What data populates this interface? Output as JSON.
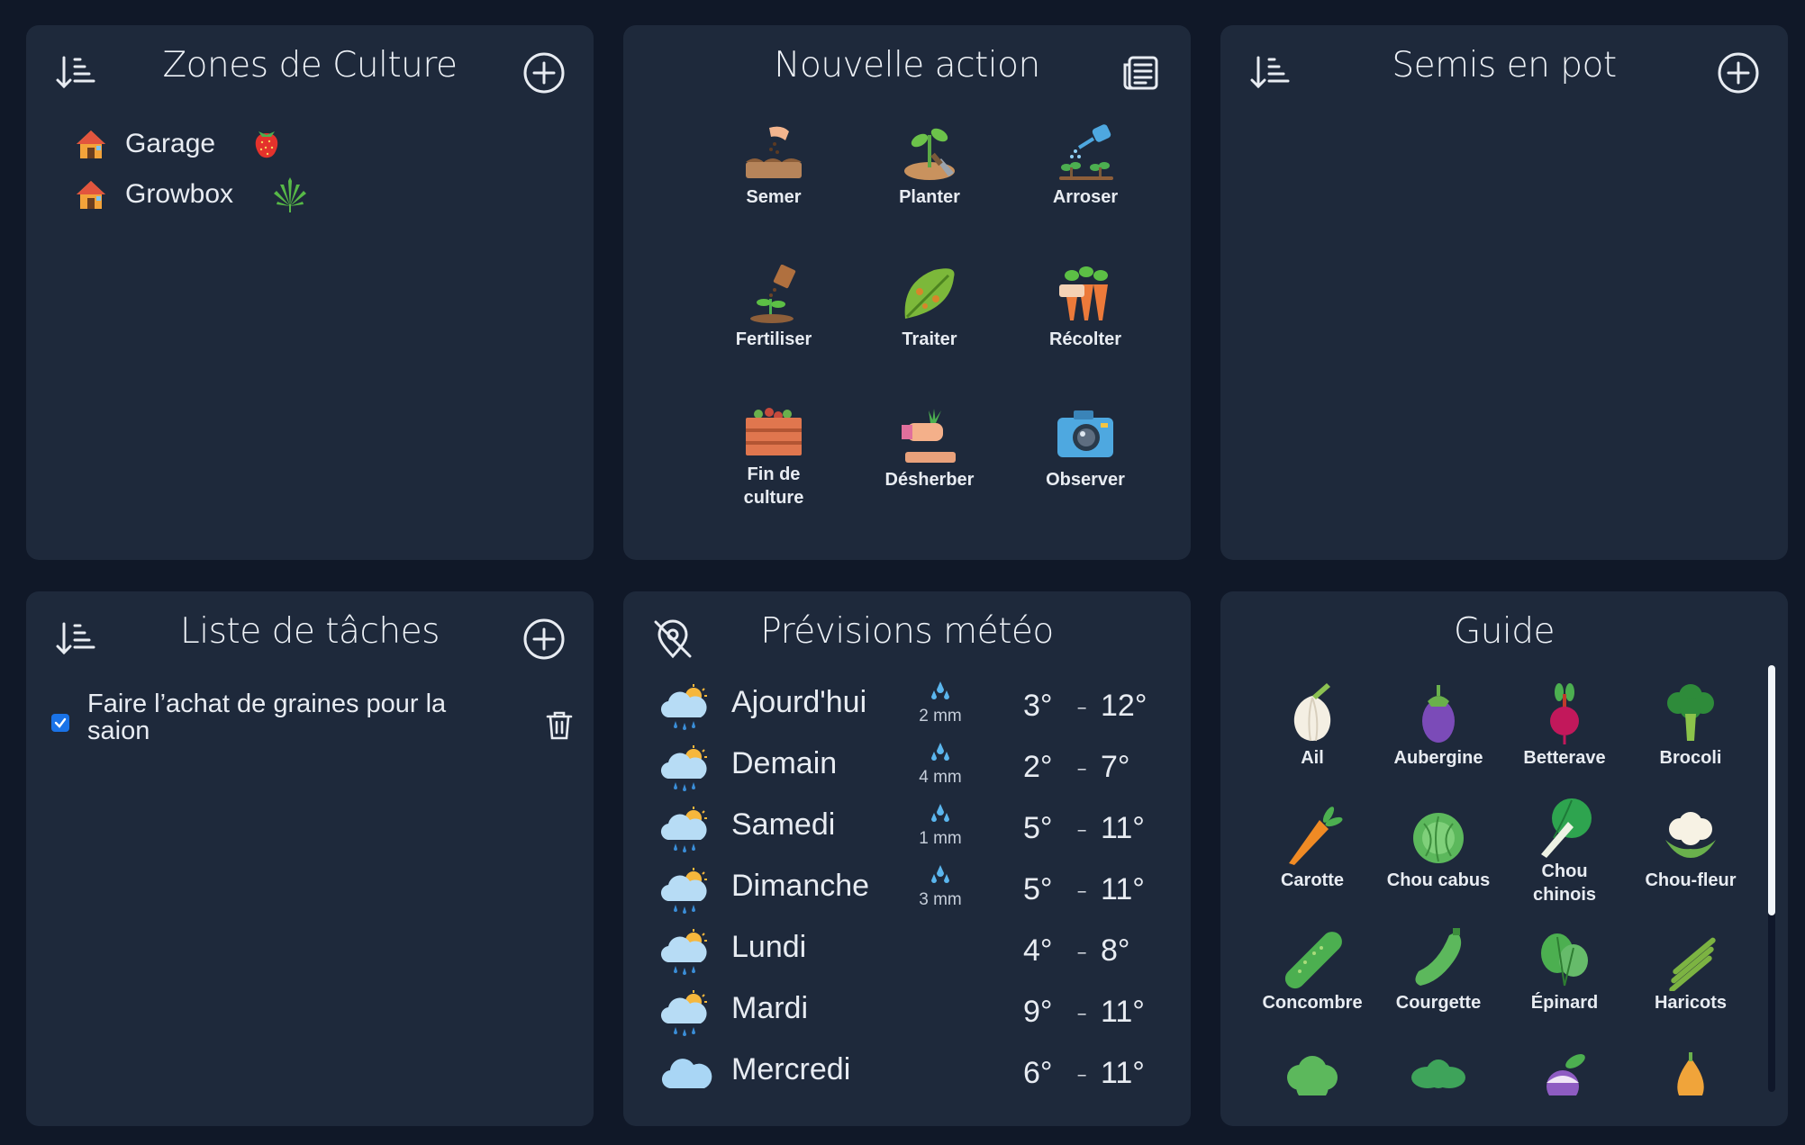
{
  "zones": {
    "title": "Zones de Culture",
    "items": [
      {
        "label": "Garage",
        "icon": "house-icon",
        "crop_icon": "strawberry-icon"
      },
      {
        "label": "Growbox",
        "icon": "house-icon",
        "crop_icon": "cannabis-leaf-icon"
      }
    ]
  },
  "actions": {
    "title": "Nouvelle action",
    "items": [
      {
        "label": "Semer",
        "icon": "sowing-icon"
      },
      {
        "label": "Planter",
        "icon": "planting-icon"
      },
      {
        "label": "Arroser",
        "icon": "watering-can-icon"
      },
      {
        "label": "Fertiliser",
        "icon": "fertilizer-icon"
      },
      {
        "label": "Traiter",
        "icon": "leaf-treatment-icon"
      },
      {
        "label": "Récolter",
        "icon": "harvest-carrots-icon"
      },
      {
        "label": "Fin de culture",
        "label_line1": "Fin de",
        "label_line2": "culture",
        "icon": "crate-icon"
      },
      {
        "label": "Désherber",
        "icon": "weeding-hand-icon"
      },
      {
        "label": "Observer",
        "icon": "camera-icon"
      }
    ]
  },
  "semis": {
    "title": "Semis en pot"
  },
  "tasks": {
    "title": "Liste de tâches",
    "items": [
      {
        "label": "Faire l’achat de graines pour la saion",
        "checked": true
      }
    ]
  },
  "meteo": {
    "title": "Prévisions météo",
    "days": [
      {
        "day": "Ajourd'hui",
        "rain": "2 mm",
        "min": "3°",
        "max": "12°",
        "icon": "rain-sun-cloud-icon"
      },
      {
        "day": "Demain",
        "rain": "4 mm",
        "min": "2°",
        "max": "7°",
        "icon": "rain-sun-cloud-icon"
      },
      {
        "day": "Samedi",
        "rain": "1 mm",
        "min": "5°",
        "max": "11°",
        "icon": "rain-sun-cloud-icon"
      },
      {
        "day": "Dimanche",
        "rain": "3 mm",
        "min": "5°",
        "max": "11°",
        "icon": "rain-sun-cloud-icon"
      },
      {
        "day": "Lundi",
        "rain": "",
        "min": "4°",
        "max": "8°",
        "icon": "rain-sun-cloud-icon"
      },
      {
        "day": "Mardi",
        "rain": "",
        "min": "9°",
        "max": "11°",
        "icon": "rain-sun-cloud-icon"
      },
      {
        "day": "Mercredi",
        "rain": "",
        "min": "6°",
        "max": "11°",
        "icon": "cloud-icon"
      }
    ],
    "dash": "-"
  },
  "guide": {
    "title": "Guide",
    "items": [
      {
        "label": "Ail",
        "icon": "garlic-icon"
      },
      {
        "label": "Aubergine",
        "icon": "eggplant-icon"
      },
      {
        "label": "Betterave",
        "icon": "beet-icon"
      },
      {
        "label": "Brocoli",
        "icon": "broccoli-icon"
      },
      {
        "label": "Carotte",
        "icon": "carrot-icon"
      },
      {
        "label": "Chou cabus",
        "icon": "cabbage-icon"
      },
      {
        "label": "Chou chinois",
        "label_line1": "Chou",
        "label_line2": "chinois",
        "icon": "bok-choy-icon"
      },
      {
        "label": "Chou-fleur",
        "icon": "cauliflower-icon"
      },
      {
        "label": "Concombre",
        "icon": "cucumber-icon"
      },
      {
        "label": "Courgette",
        "icon": "zucchini-icon"
      },
      {
        "label": "Épinard",
        "icon": "spinach-icon"
      },
      {
        "label": "Haricots",
        "icon": "green-beans-icon"
      },
      {
        "label": "",
        "icon": "lettuce-icon"
      },
      {
        "label": "",
        "icon": "kale-icon"
      },
      {
        "label": "",
        "icon": "turnip-icon"
      },
      {
        "label": "",
        "icon": "onion-icon"
      }
    ]
  },
  "colors": {
    "background": "#101828",
    "card": "#1e293b",
    "text": "#e8ecf2",
    "checkbox": "#1a73e8",
    "rain_drop": "#5bb6ee"
  }
}
